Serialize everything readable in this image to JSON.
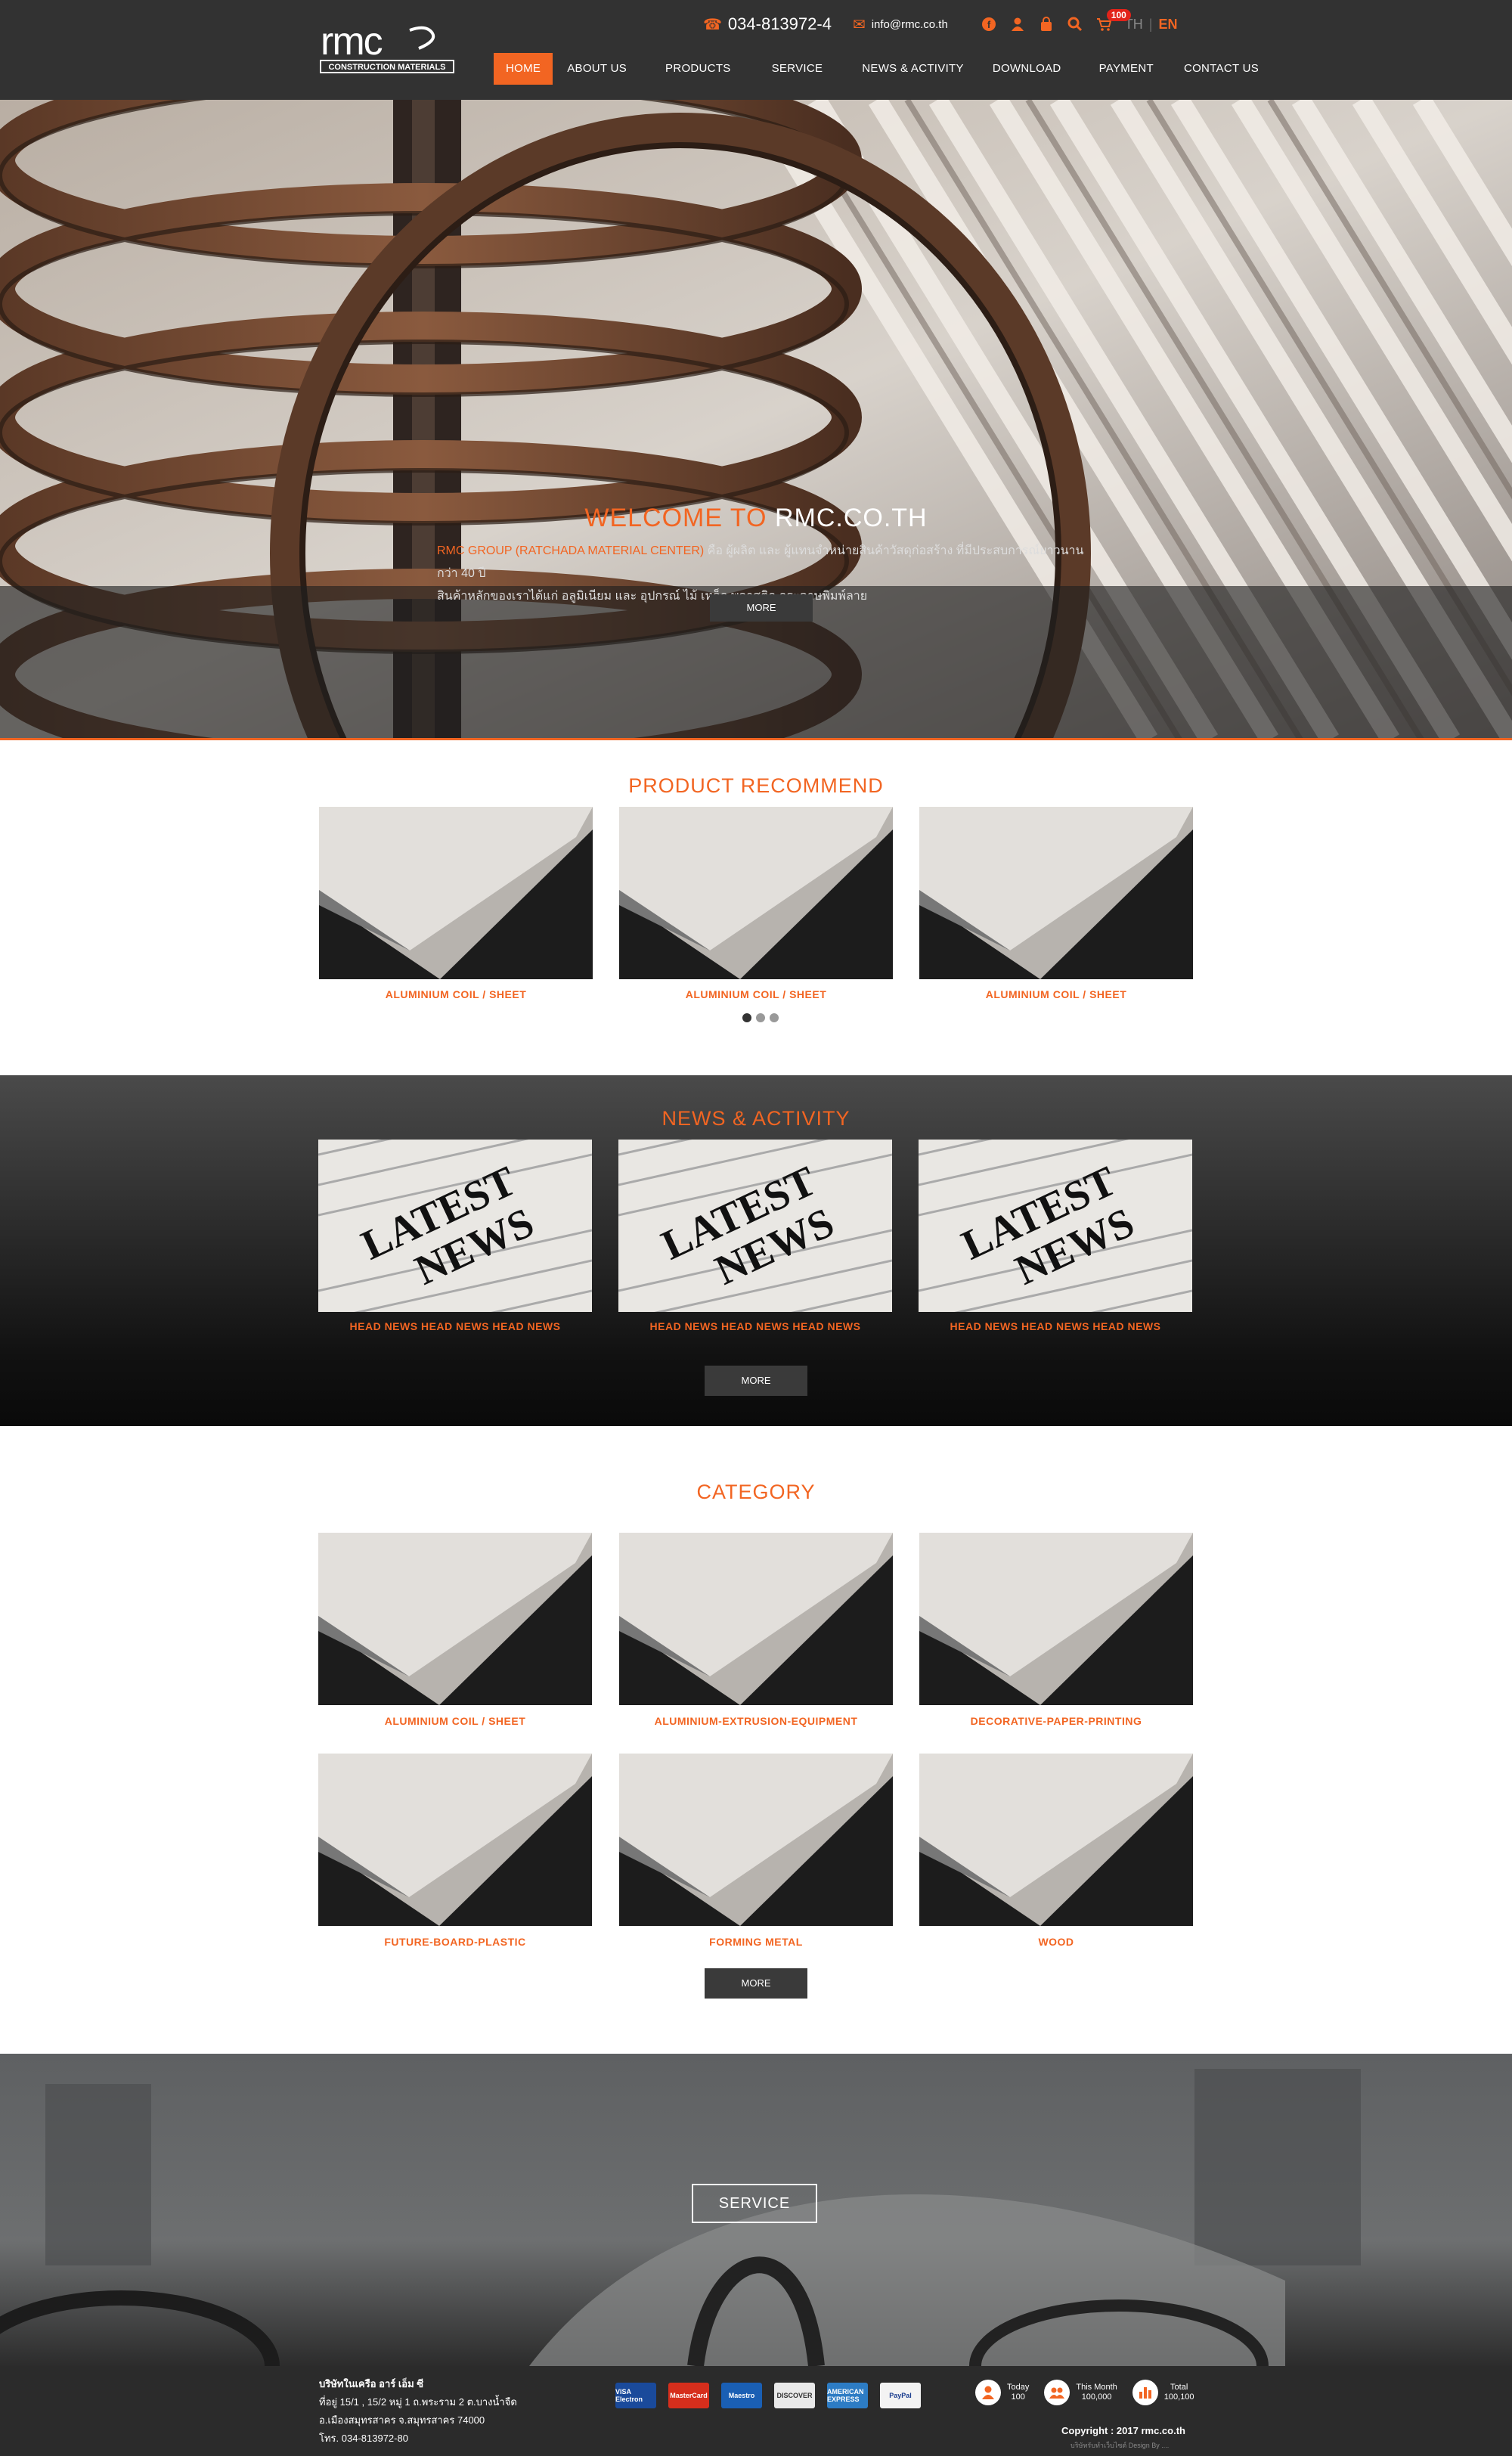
{
  "header": {
    "phone": "034-813972-4",
    "email": "info@rmc.co.th",
    "cart_count": "100",
    "lang_th": "TH",
    "lang_sep": "|",
    "lang_en": "EN",
    "logo_sub": "CONSTRUCTION MATERIALS"
  },
  "nav": {
    "home": "HOME",
    "about": "ABOUT US",
    "products": "PRODUCTS",
    "service": "SERVICE",
    "news": "NEWS & ACTIVITY",
    "download": "DOWNLOAD",
    "payment": "PAYMENT",
    "contact": "CONTACT US"
  },
  "hero": {
    "title_orange": "WELCOME TO",
    "title_white": "RMC.CO.TH",
    "desc_orange": "RMC GROUP (RATCHADA MATERIAL CENTER)",
    "desc_rest": " คือ ผู้ผลิต และ ผู้แทนจำหน่ายสินค้าวัสดุก่อสร้าง ที่มีประสบการณ์ยาวนานกว่า 40 ปี",
    "desc_line2": "สินค้าหลักของเราได้แก่ อลูมิเนียม และ อุปกรณ์ ไม้ เหล็ก พลาสติก กระดาษพิมพ์ลาย",
    "more": "MORE"
  },
  "recommend": {
    "title": "PRODUCT RECOMMEND",
    "items": [
      {
        "caption": "ALUMINIUM COIL / SHEET"
      },
      {
        "caption": "ALUMINIUM COIL / SHEET"
      },
      {
        "caption": "ALUMINIUM COIL / SHEET"
      }
    ]
  },
  "news": {
    "title": "NEWS & ACTIVITY",
    "items": [
      {
        "caption": "HEAD NEWS HEAD NEWS HEAD NEWS",
        "img_text1": "LATEST",
        "img_text2": "NEWS"
      },
      {
        "caption": "HEAD NEWS HEAD NEWS HEAD NEWS",
        "img_text1": "LATEST",
        "img_text2": "NEWS"
      },
      {
        "caption": "HEAD NEWS HEAD NEWS HEAD NEWS",
        "img_text1": "LATEST",
        "img_text2": "NEWS"
      }
    ],
    "more": "MORE"
  },
  "category": {
    "title": "CATEGORY",
    "items": [
      {
        "caption": "ALUMINIUM COIL / SHEET"
      },
      {
        "caption": "ALUMINIUM-EXTRUSION-EQUIPMENT"
      },
      {
        "caption": "DECORATIVE-PAPER-PRINTING"
      },
      {
        "caption": "FUTURE-BOARD-PLASTIC"
      },
      {
        "caption": "FORMING METAL"
      },
      {
        "caption": "WOOD"
      }
    ],
    "more": "MORE"
  },
  "service": {
    "button": "SERVICE"
  },
  "footer": {
    "company": "บริษัทในเครือ อาร์ เอ็ม ซี",
    "address1": "ที่อยู่ 15/1 , 15/2 หมู่ 1 ถ.พระราม 2 ต.บางน้ำจืด",
    "address2": "อ.เมืองสมุทรสาคร จ.สมุทรสาคร 74000",
    "phone": "โทร. 034-813972-80",
    "payments": [
      {
        "label": "VISA Electron",
        "color": "#1a4a9b"
      },
      {
        "label": "MasterCard",
        "color": "#d62e1c"
      },
      {
        "label": "Maestro",
        "color": "#1a5fb4"
      },
      {
        "label": "DISCOVER",
        "color": "#e9e9e9"
      },
      {
        "label": "AMERICAN EXPRESS",
        "color": "#2d7cc4"
      },
      {
        "label": "PayPal",
        "color": "#f3f3f3"
      }
    ],
    "today_label": "Today",
    "today_value": "100",
    "month_label": "This Month",
    "month_value": "100,000",
    "total_label": "Total",
    "total_value": "100,100",
    "copyright": "Copyright : 2017 rmc.co.th",
    "design": "บริษัทรับทำเว็บไซต์ Design By ....",
    "accent": "#f26522"
  }
}
